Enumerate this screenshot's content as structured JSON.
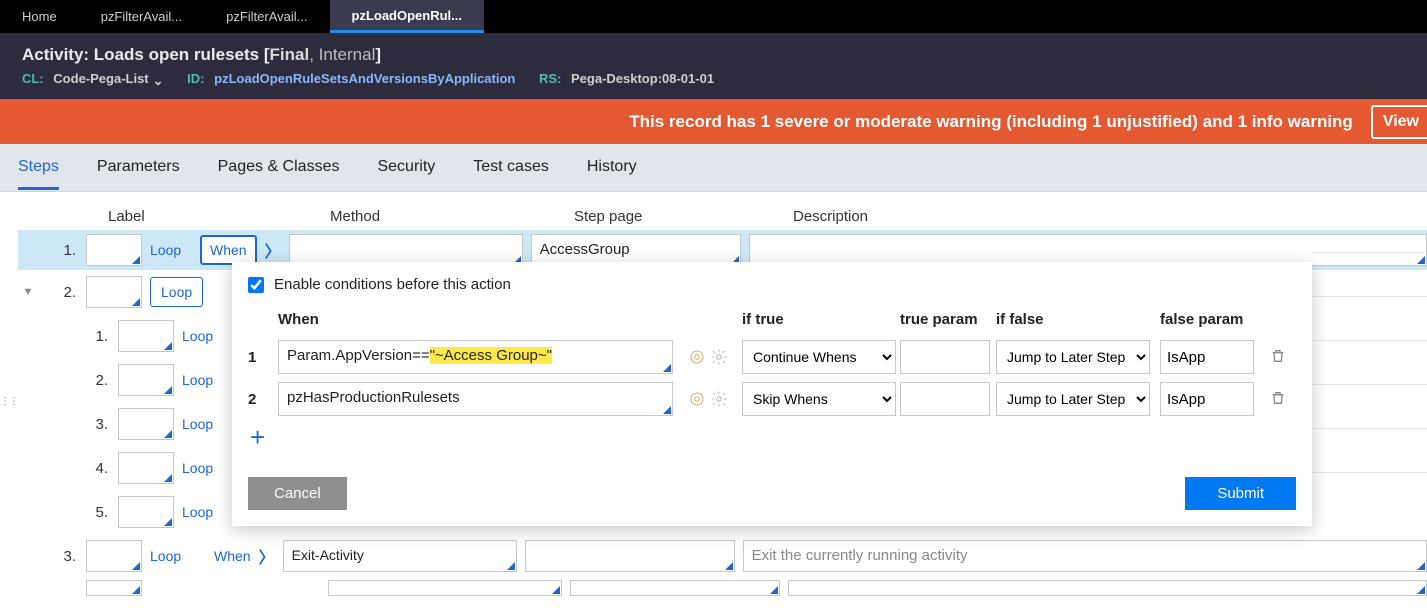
{
  "top_tabs": {
    "home": "Home",
    "tab1": "pzFilterAvail...",
    "tab2": "pzFilterAvail...",
    "active": "pzLoadOpenRul..."
  },
  "header": {
    "title_prefix": "Activity: ",
    "title_name": "Loads open rulesets",
    "bracket_open": " [",
    "final_label": "Final",
    "comma": ", ",
    "internal_label": "Internal",
    "bracket_close": "]",
    "cl_key": "CL:",
    "cl_val": "Code-Pega-List",
    "id_key": "ID:",
    "id_val": "pzLoadOpenRuleSetsAndVersionsByApplication",
    "rs_key": "RS:",
    "rs_val": "Pega-Desktop:08-01-01"
  },
  "warning": {
    "text": "This record has 1 severe or moderate warning (including 1 unjustified) and 1 info warning",
    "view_btn": "View"
  },
  "rule_tabs": [
    "Steps",
    "Parameters",
    "Pages & Classes",
    "Security",
    "Test cases",
    "History"
  ],
  "columns": {
    "label": "Label",
    "method": "Method",
    "page": "Step page",
    "desc": "Description"
  },
  "loop_label": "Loop",
  "when_label": "When",
  "steps": {
    "s1": {
      "num": "1.",
      "page": "AccessGroup"
    },
    "s2": {
      "num": "2."
    },
    "sub": [
      "1.",
      "2.",
      "3.",
      "4.",
      "5."
    ],
    "s3": {
      "num": "3.",
      "method": "Exit-Activity",
      "desc_placeholder": "Exit the currently running activity"
    }
  },
  "popup": {
    "enable_label": "Enable conditions before this action",
    "headers": {
      "when": "When",
      "iftrue": "if true",
      "trueparam": "true param",
      "iffalse": "if false",
      "falseparam": "false param"
    },
    "rows": [
      {
        "n": "1",
        "when_pre": "Param.AppVersion==",
        "when_hl": "\"~Access Group~\"",
        "if_true": "Continue Whens",
        "true_param": "",
        "if_false": "Jump to Later Step",
        "false_param": "IsApp"
      },
      {
        "n": "2",
        "when_pre": "pzHasProductionRulesets",
        "when_hl": "",
        "if_true": "Skip Whens",
        "true_param": "",
        "if_false": "Jump to Later Step",
        "false_param": "IsApp"
      }
    ],
    "cancel": "Cancel",
    "submit": "Submit"
  }
}
